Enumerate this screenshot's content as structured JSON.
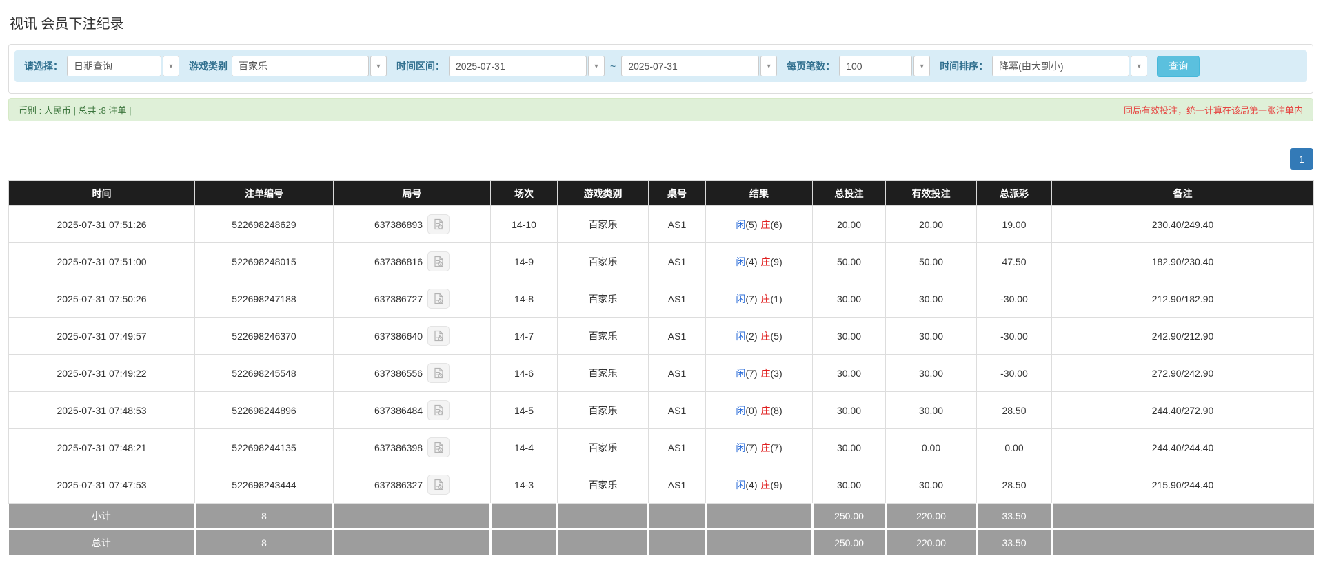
{
  "page": {
    "title": "视讯 会员下注纪录"
  },
  "filters": {
    "select_label": "请选择：",
    "select_value": "日期查询",
    "game_label": "游戏类别",
    "game_value": "百家乐",
    "range_label": "时间区间：",
    "range_from": "2025-07-31",
    "range_separator": "~",
    "range_to": "2025-07-31",
    "per_page_label": "每页笔数：",
    "per_page_value": "100",
    "sort_label": "时间排序：",
    "sort_value": "降冪(由大到小)",
    "search_button": "查询",
    "dropdown_arrow": "▼"
  },
  "summary_bar": {
    "left_text": "币别 : 人民币 | 总共 :8 注单 |",
    "right_note": "同局有效投注，统一计算在该局第一张注单内"
  },
  "pagination": {
    "current_page": "1"
  },
  "table": {
    "headers": [
      "时间",
      "注单编号",
      "局号",
      "场次",
      "游戏类别",
      "桌号",
      "结果",
      "总投注",
      "有效投注",
      "总派彩",
      "备注"
    ],
    "rows": [
      {
        "time": "2025-07-31 07:51:26",
        "bet_id": "522698248629",
        "round_id": "637386893",
        "session": "14-10",
        "game_type": "百家乐",
        "table_no": "AS1",
        "result": {
          "player_label": "闲",
          "player_pts": "(5)",
          "banker_label": "庄",
          "banker_pts": "(6)"
        },
        "total_bet": "20.00",
        "valid_bet": "20.00",
        "payout": "19.00",
        "note": "230.40/249.40"
      },
      {
        "time": "2025-07-31 07:51:00",
        "bet_id": "522698248015",
        "round_id": "637386816",
        "session": "14-9",
        "game_type": "百家乐",
        "table_no": "AS1",
        "result": {
          "player_label": "闲",
          "player_pts": "(4)",
          "banker_label": "庄",
          "banker_pts": "(9)"
        },
        "total_bet": "50.00",
        "valid_bet": "50.00",
        "payout": "47.50",
        "note": "182.90/230.40"
      },
      {
        "time": "2025-07-31 07:50:26",
        "bet_id": "522698247188",
        "round_id": "637386727",
        "session": "14-8",
        "game_type": "百家乐",
        "table_no": "AS1",
        "result": {
          "player_label": "闲",
          "player_pts": "(7)",
          "banker_label": "庄",
          "banker_pts": "(1)"
        },
        "total_bet": "30.00",
        "valid_bet": "30.00",
        "payout": "-30.00",
        "note": "212.90/182.90"
      },
      {
        "time": "2025-07-31 07:49:57",
        "bet_id": "522698246370",
        "round_id": "637386640",
        "session": "14-7",
        "game_type": "百家乐",
        "table_no": "AS1",
        "result": {
          "player_label": "闲",
          "player_pts": "(2)",
          "banker_label": "庄",
          "banker_pts": "(5)"
        },
        "total_bet": "30.00",
        "valid_bet": "30.00",
        "payout": "-30.00",
        "note": "242.90/212.90"
      },
      {
        "time": "2025-07-31 07:49:22",
        "bet_id": "522698245548",
        "round_id": "637386556",
        "session": "14-6",
        "game_type": "百家乐",
        "table_no": "AS1",
        "result": {
          "player_label": "闲",
          "player_pts": "(7)",
          "banker_label": "庄",
          "banker_pts": "(3)"
        },
        "total_bet": "30.00",
        "valid_bet": "30.00",
        "payout": "-30.00",
        "note": "272.90/242.90"
      },
      {
        "time": "2025-07-31 07:48:53",
        "bet_id": "522698244896",
        "round_id": "637386484",
        "session": "14-5",
        "game_type": "百家乐",
        "table_no": "AS1",
        "result": {
          "player_label": "闲",
          "player_pts": "(0)",
          "banker_label": "庄",
          "banker_pts": "(8)"
        },
        "total_bet": "30.00",
        "valid_bet": "30.00",
        "payout": "28.50",
        "note": "244.40/272.90"
      },
      {
        "time": "2025-07-31 07:48:21",
        "bet_id": "522698244135",
        "round_id": "637386398",
        "session": "14-4",
        "game_type": "百家乐",
        "table_no": "AS1",
        "result": {
          "player_label": "闲",
          "player_pts": "(7)",
          "banker_label": "庄",
          "banker_pts": "(7)"
        },
        "total_bet": "30.00",
        "valid_bet": "0.00",
        "payout": "0.00",
        "note": "244.40/244.40"
      },
      {
        "time": "2025-07-31 07:47:53",
        "bet_id": "522698243444",
        "round_id": "637386327",
        "session": "14-3",
        "game_type": "百家乐",
        "table_no": "AS1",
        "result": {
          "player_label": "闲",
          "player_pts": "(4)",
          "banker_label": "庄",
          "banker_pts": "(9)"
        },
        "total_bet": "30.00",
        "valid_bet": "30.00",
        "payout": "28.50",
        "note": "215.90/244.40"
      }
    ],
    "subtotal": {
      "label": "小计",
      "count": "8",
      "total_bet": "250.00",
      "valid_bet": "220.00",
      "payout": "33.50"
    },
    "total": {
      "label": "总计",
      "count": "8",
      "total_bet": "250.00",
      "valid_bet": "220.00",
      "payout": "33.50"
    }
  },
  "colors": {
    "filter_bar_bg": "#d9edf7",
    "filter_label": "#31708f",
    "search_button_bg": "#5bc0de",
    "summary_bar_bg": "#dff0d8",
    "summary_text": "#3c763d",
    "warning_red": "#e64542",
    "header_bg": "#1e1e1e",
    "link_blue": "#2b6cd8",
    "player_blue": "#2b6cd8",
    "banker_red": "#e02020",
    "negative_red": "#e02020",
    "summary_row_bg": "#9d9d9d",
    "pagination_bg": "#337ab7"
  }
}
